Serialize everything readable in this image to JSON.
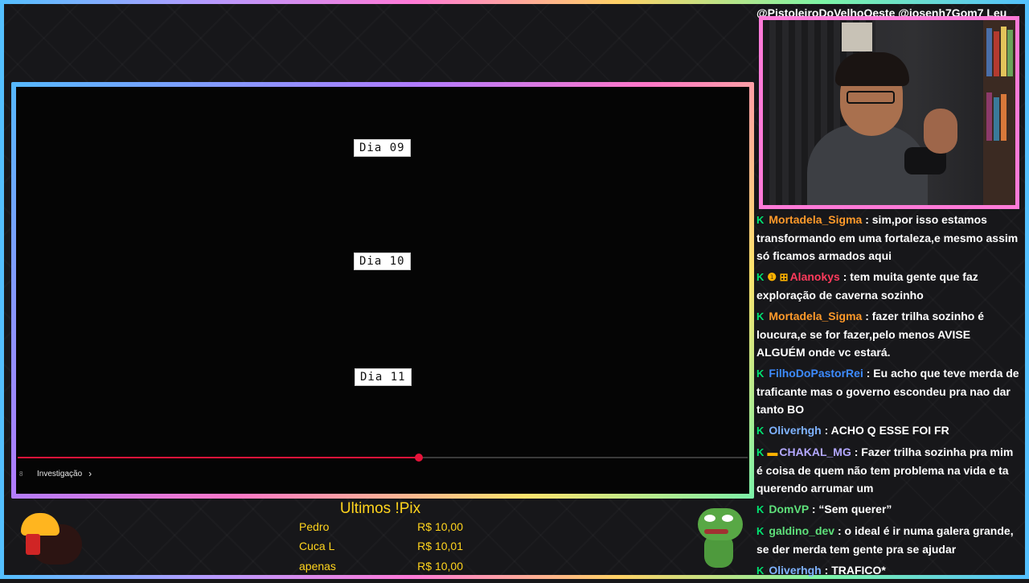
{
  "colors": {
    "accent_red": "#e8133a",
    "pix_yellow": "#ffd41d",
    "badge_green": "#00e571"
  },
  "video": {
    "day_labels": [
      "Dia 09",
      "Dia 10",
      "Dia 11"
    ],
    "progress_fraction": 0.55,
    "chapter_time": "8",
    "chapter_label": "Investigação",
    "chapter_icon": "chevron-right-icon"
  },
  "chat": {
    "top_overflow": "@PistoleiroDoVelhoOeste @josenh7Gom7 Leu",
    "messages": [
      {
        "user": "Mortadela_Sigma",
        "color": "#ff9a2a",
        "badges": "K",
        "extra": "",
        "text": ": sim,por isso estamos transformando em uma fortaleza,e mesmo assim só ficamos armados aqui"
      },
      {
        "user": "Alanokys",
        "color": "#ff3b5c",
        "badges": "K",
        "extra": "❶ ⊞",
        "text": ": tem muita gente que faz exploração de caverna sozinho"
      },
      {
        "user": "Mortadela_Sigma",
        "color": "#ff9a2a",
        "badges": "K",
        "extra": "",
        "text": ": fazer trilha sozinho é loucura,e se for fazer,pelo menos AVISE ALGUÉM onde vc estará."
      },
      {
        "user": "FilhoDoPastorRei",
        "color": "#3d8bff",
        "badges": "K",
        "extra": "",
        "text": ": Eu acho que teve merda de traficante mas o governo escondeu pra nao dar tanto BO"
      },
      {
        "user": "Oliverhgh",
        "color": "#7fb3ff",
        "badges": "K",
        "extra": "",
        "text": ": ACHO Q ESSE FOI FR"
      },
      {
        "user": "CHAKAL_MG",
        "color": "#b3a8ff",
        "badges": "K",
        "extra": "▬",
        "text": ": Fazer trilha sozinha pra mim é coisa de quem não tem problema na vida e ta querendo arrumar um"
      },
      {
        "user": "DomVP",
        "color": "#5ee07a",
        "badges": "K",
        "extra": "",
        "text": ": “Sem querer”"
      },
      {
        "user": "galdino_dev",
        "color": "#5ee07a",
        "badges": "K",
        "extra": "",
        "text": ": o ideal é ir numa galera grande, se der merda tem gente pra se ajudar"
      },
      {
        "user": "Oliverhgh",
        "color": "#7fb3ff",
        "badges": "K",
        "extra": "",
        "text": ": TRAFICO*"
      }
    ]
  },
  "pix": {
    "title": "Ultimos !Pix",
    "rows": [
      {
        "name": "Pedro",
        "amount": "R$ 10,00"
      },
      {
        "name": "Cuca L",
        "amount": "R$ 10,01"
      },
      {
        "name": "apenas",
        "amount": "R$ 10,00"
      }
    ]
  }
}
